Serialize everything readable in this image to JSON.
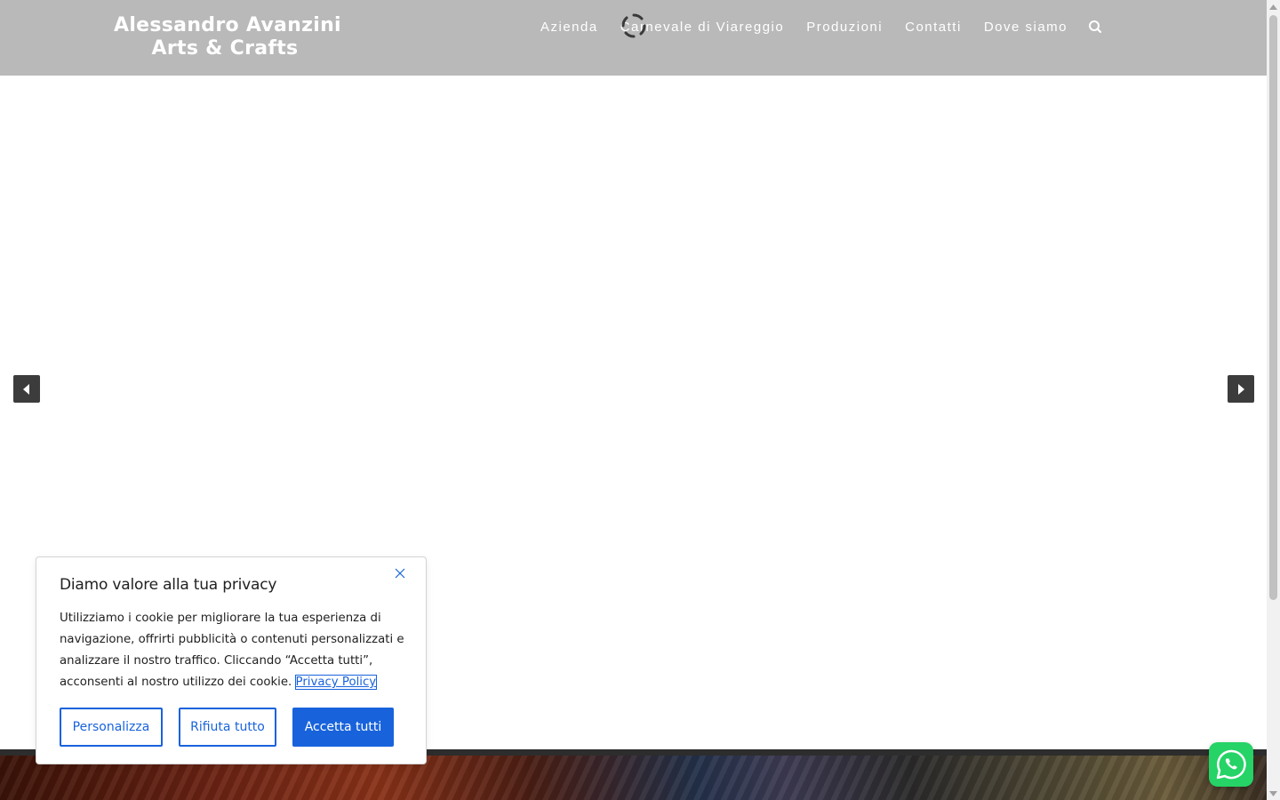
{
  "header": {
    "logo_line1": "Alessandro Avanzini",
    "logo_line2": "Arts & Crafts",
    "nav": [
      {
        "label": "Azienda"
      },
      {
        "label": "Carnevale di Viareggio"
      },
      {
        "label": "Produzioni"
      },
      {
        "label": "Contatti"
      },
      {
        "label": "Dove siamo"
      }
    ],
    "search_icon": "search-icon",
    "background": "#b9b9b9"
  },
  "slider": {
    "prev_icon": "triangle-left-icon",
    "next_icon": "triangle-right-icon",
    "loading_icon": "spinner-icon"
  },
  "cookie_banner": {
    "title": "Diamo valore alla tua privacy",
    "text": "Utilizziamo i cookie per migliorare la tua esperienza di navigazione, offrirti pubblicità o contenuti personalizzati e analizzare il nostro traffico. Cliccando “Accetta tutti”, acconsenti al nostro utilizzo dei cookie.",
    "link_label": "Privacy Policy",
    "customize_label": "Personalizza",
    "reject_label": "Rifiuta tutto",
    "accept_label": "Accetta tutti",
    "accent_color": "#1863dc",
    "close_icon": "close-icon"
  },
  "whatsapp": {
    "icon": "whatsapp-icon",
    "color": "#25d366"
  }
}
